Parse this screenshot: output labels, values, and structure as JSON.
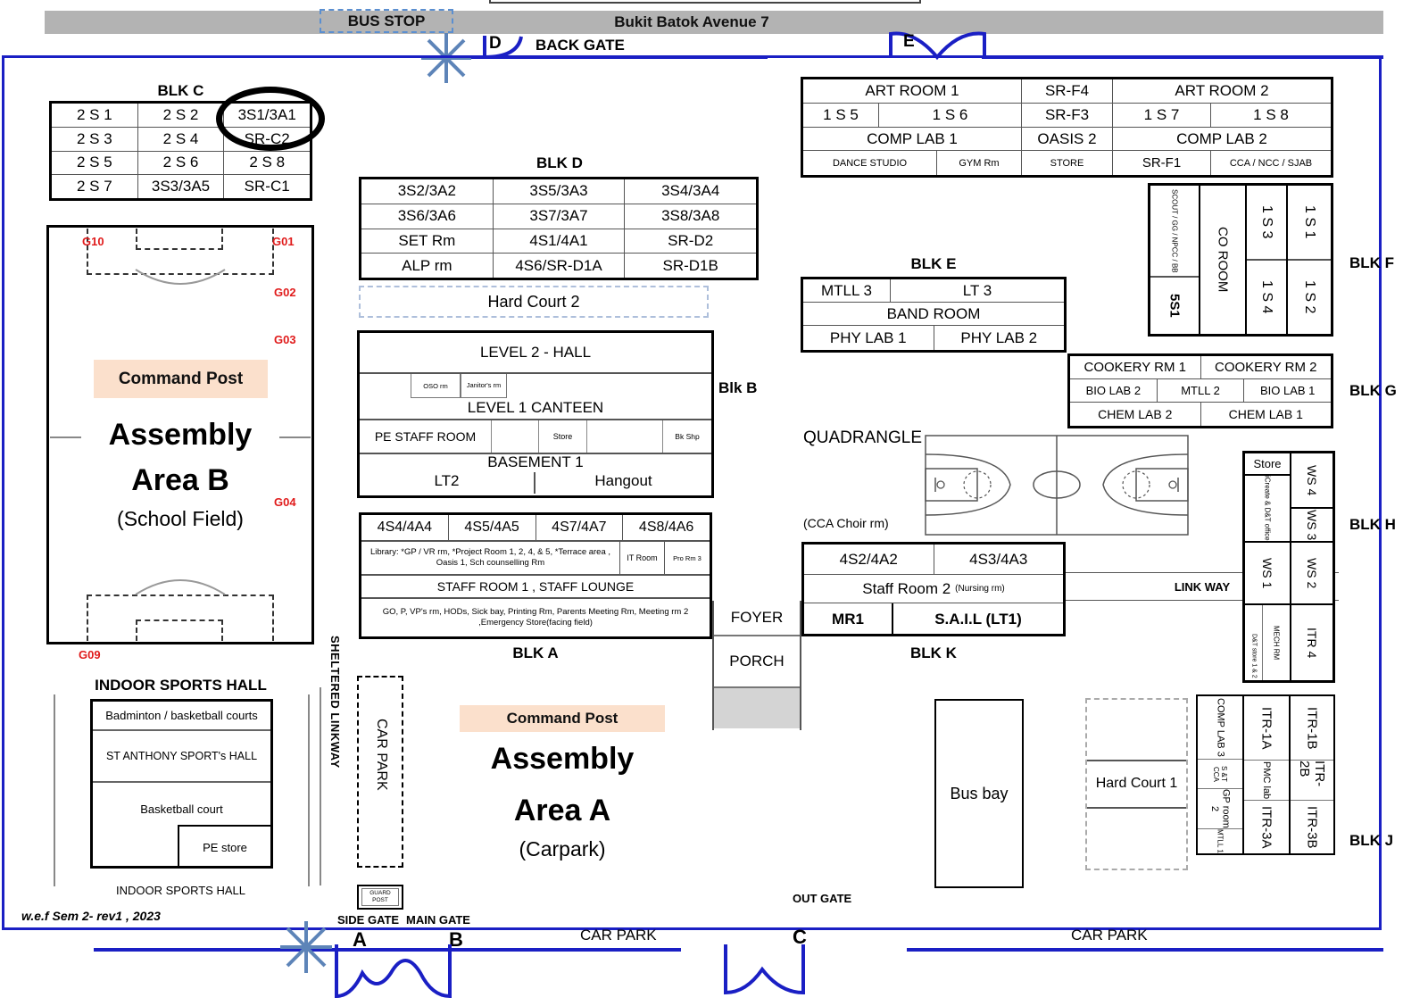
{
  "street": {
    "name": "Bukit Batok Avenue 7",
    "bus_stop": "BUS STOP",
    "back_gate": "BACK GATE",
    "gate_d": "D",
    "gate_e": "E"
  },
  "blk_c": {
    "label": "BLK C",
    "rows": [
      [
        "2 S 1",
        "2 S 2",
        "3S1/3A1"
      ],
      [
        "2 S 3",
        "2 S 4",
        "SR-C2"
      ],
      [
        "2 S 5",
        "2 S 6",
        "2 S 8"
      ],
      [
        "2 S 7",
        "3S3/3A5",
        "SR-C1"
      ]
    ]
  },
  "blk_d": {
    "label": "BLK D",
    "rows": [
      [
        "3S2/3A2",
        "3S5/3A3",
        "3S4/3A4"
      ],
      [
        "3S6/3A6",
        "3S7/3A7",
        "3S8/3A8"
      ],
      [
        "SET Rm",
        "4S1/4A1",
        "SR-D2"
      ],
      [
        "ALP rm",
        "4S6/SR-D1A",
        "SR-D1B"
      ]
    ]
  },
  "hard_court_2": "Hard Court 2",
  "blk_b": {
    "label": "Blk B",
    "level2_hall": "LEVEL 2 - HALL",
    "oso_rm": "OSO rm",
    "janitors_rm": "Janitor's rm",
    "level1_canteen": "LEVEL 1 CANTEEN",
    "pe_staff_room": "PE STAFF ROOM",
    "store": "Store",
    "bk_shp": "Bk Shp",
    "basement1": "BASEMENT 1",
    "lt2": "LT2",
    "hangout": "Hangout"
  },
  "blk_a": {
    "label": "BLK A",
    "classrooms": [
      "4S4/4A4",
      "4S5/4A5",
      "4S7/4A7",
      "4S8/4A6"
    ],
    "library": "Library: *GP / VR rm, *Project Room 1, 2, 4, & 5, *Terrace area , Oasis 1, Sch counselling Rm",
    "it_room": "IT Room",
    "pro_rm_3": "Pro Rm 3",
    "staff_room": "STAFF ROOM 1 , STAFF LOUNGE",
    "admin": "GO, P, VP's rm, HODs, Sick bay, Printing Rm, Parents Meeting Rm, Meeting rm 2 ,Emergency Store(facing field)"
  },
  "blk_f": {
    "label": "BLK F",
    "top_rows": [
      [
        "ART ROOM 1",
        "SR-F4",
        "ART ROOM 2"
      ],
      [
        "1 S 5",
        "1 S 6",
        "SR-F3",
        "1 S 7",
        "1 S 8"
      ],
      [
        "COMP LAB 1",
        "OASIS 2",
        "COMP LAB 2"
      ],
      [
        "DANCE STUDIO",
        "GYM Rm",
        "STORE",
        "SR-F1",
        "CCA  / NCC / SJAB"
      ]
    ],
    "vertical": {
      "scout": "SCOUT / GG / NPCC / BB",
      "ss1": "5S1",
      "co_room": "CO ROOM",
      "s3": "1 S 3",
      "s4": "1 S 4",
      "s1": "1 S 1",
      "s2": "1 S 2"
    }
  },
  "blk_e": {
    "label": "BLK E",
    "rows": [
      [
        "MTLL 3",
        "LT 3"
      ],
      [
        "BAND ROOM"
      ],
      [
        "PHY LAB 1",
        "PHY LAB 2"
      ]
    ]
  },
  "blk_g": {
    "label": "BLK G",
    "rows": [
      [
        "COOKERY RM 1",
        "COOKERY RM 2"
      ],
      [
        "BIO LAB 2",
        "MTLL 2",
        "BIO LAB 1"
      ],
      [
        "CHEM LAB 2",
        "CHEM LAB 1"
      ]
    ]
  },
  "blk_h": {
    "label": "BLK H",
    "store": "Store",
    "icreate": "iCreate & D&T office",
    "ws4": "WS 4",
    "ws3": "WS 3",
    "ws1": "WS 1",
    "ws2": "WS 2",
    "mech_rm": "MECH RM",
    "dt_store": "D&T store 1 & 2",
    "itr4": "ITR 4"
  },
  "blk_j": {
    "label": "BLK J",
    "comp_lab3": "COMP LAB 3",
    "s_t_cca": "S &T CCA",
    "gp_room2": "GP room 2",
    "mtll1": "MTLL 1",
    "itr1a": "ITR-1A",
    "pmc_lab": "PMC lab",
    "itr3a": "ITR-3A",
    "itr1b": "ITR-1B",
    "itr2b": "ITR-2B",
    "itr3b": "ITR-3B"
  },
  "blk_k": {
    "label": "BLK K",
    "quadrangle": "QUADRANGLE",
    "cca_choir": "(CCA Choir rm)",
    "classrooms": [
      "4S2/4A2",
      "4S3/4A3"
    ],
    "staff_room2": "Staff Room 2",
    "nursing_rm": "(Nursing rm)",
    "link_way": "LINK WAY",
    "foyer": "FOYER",
    "porch": "PORCH",
    "mr1": "MR1",
    "sail": "S.A.I.L  (LT1)"
  },
  "field_b": {
    "command_post": "Command Post",
    "title_line1": "Assembly",
    "title_line2": "Area B",
    "subtitle": "(School Field)",
    "gates": [
      "G10",
      "G01",
      "G02",
      "G03",
      "G04",
      "G09"
    ]
  },
  "sports_hall": {
    "title_top": "INDOOR SPORTS HALL",
    "title_bottom": "INDOOR SPORTS HALL",
    "rows": [
      "Badminton / basketball courts",
      "ST ANTHONY SPORT's HALL",
      "Basketball court",
      "PE store"
    ]
  },
  "carpark_a": {
    "command_post": "Command Post",
    "title_line1": "Assembly",
    "title_line2": "Area A",
    "subtitle": "(Carpark)",
    "car_park": "CAR PARK",
    "guard_post": "GUARD POST",
    "side_gate": "SIDE GATE",
    "main_gate": "MAIN GATE",
    "gate_a": "A",
    "gate_b": "B"
  },
  "sheltered_linkway": "SHELTERED LINKWAY",
  "bus_bay": "Bus bay",
  "hard_court_1": "Hard Court 1",
  "out_gate": "OUT GATE",
  "gate_c": "C",
  "car_park_bottom_left": "CAR PARK",
  "car_park_bottom_right": "CAR PARK",
  "revision": "w.e.f Sem 2- rev1 , 2023"
}
